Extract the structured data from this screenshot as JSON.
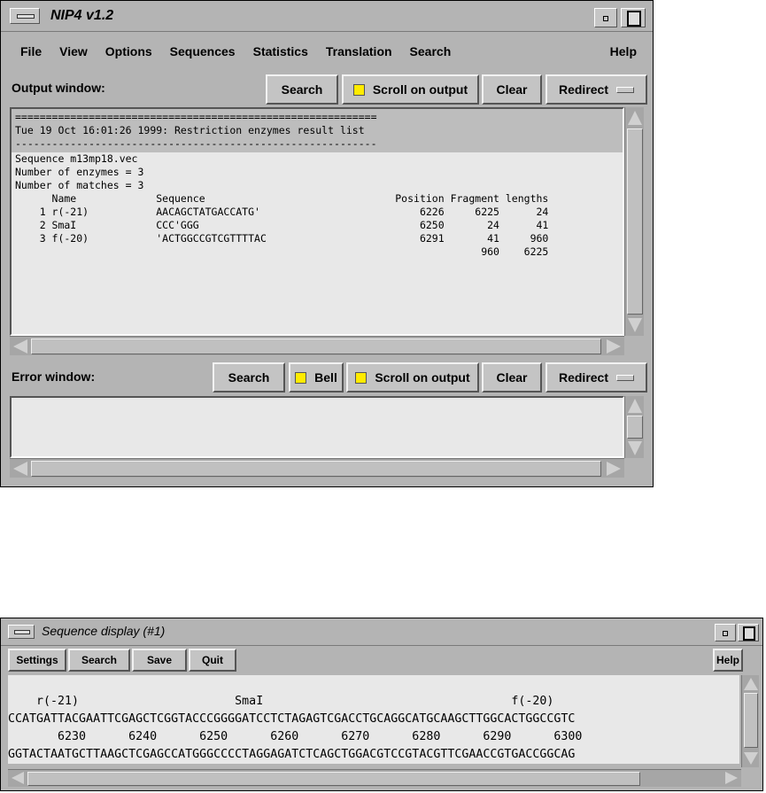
{
  "nip4": {
    "title": "NIP4 v1.2",
    "menu": [
      "File",
      "View",
      "Options",
      "Sequences",
      "Statistics",
      "Translation",
      "Search",
      "Help"
    ],
    "output": {
      "label": "Output window:",
      "search_label": "Search",
      "scroll_label": "Scroll on output",
      "clear_label": "Clear",
      "redirect_label": "Redirect",
      "highlight_lines": [
        "===========================================================",
        "Tue 19 Oct 16:01:26 1999: Restriction enzymes result list",
        "-----------------------------------------------------------"
      ],
      "lines": [
        "Sequence m13mp18.vec",
        "Number of enzymes = 3",
        "Number of matches = 3",
        "      Name             Sequence                               Position Fragment lengths",
        "    1 r(-21)           AACAGCTATGACCATG'                          6226     6225      24",
        "    2 SmaI             CCC'GGG                                    6250       24      41",
        "    3 f(-20)           'ACTGGCCGTCGTTTTAC                         6291       41     960",
        "                                                                            960    6225"
      ]
    },
    "error": {
      "label": "Error window:",
      "search_label": "Search",
      "bell_label": "Bell",
      "scroll_label": "Scroll on output",
      "clear_label": "Clear",
      "redirect_label": "Redirect"
    }
  },
  "seqdisplay": {
    "title": "Sequence display (#1)",
    "toolbar": {
      "settings": "Settings",
      "search": "Search",
      "save": "Save",
      "quit": "Quit",
      "help": "Help"
    },
    "lines": [
      "",
      "    r(-21)                      SmaI                                   f(-20)",
      "CCATGATTACGAATTCGAGCTCGGTACCCGGGGATCCTCTAGAGTCGACCTGCAGGCATGCAAGCTTGGCACTGGCCGTC",
      "       6230      6240      6250      6260      6270      6280      6290      6300",
      "GGTACTAATGCTTAAGCTCGAGCCATGGGCCCCTAGGAGATCTCAGCTGGACGTCCGTACGTTCGAACCGTGACCGGCAG"
    ]
  }
}
